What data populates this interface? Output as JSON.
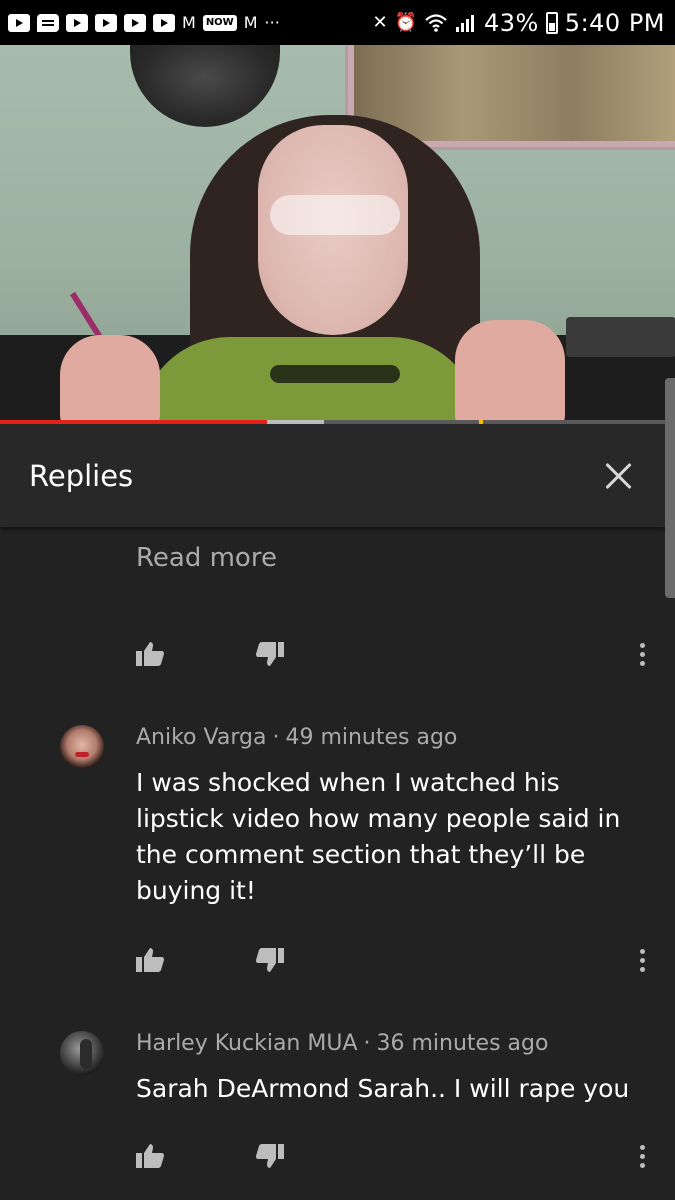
{
  "status_bar": {
    "notif_letter_1": "M",
    "notif_badge": "NOW",
    "notif_letter_2": "M",
    "overflow": "···",
    "battery_pct": "43%",
    "time": "5:40 PM"
  },
  "video": {
    "progress_fraction": 0.395,
    "buffer_fraction": 0.48,
    "marker_fraction": 0.71
  },
  "panel": {
    "title": "Replies"
  },
  "truncated_comment": {
    "read_more_label": "Read more"
  },
  "comments": [
    {
      "author": "Aniko Varga",
      "separator": "·",
      "time": "49 minutes ago",
      "text": "I was shocked when I watched his lipstick video how many people said in the comment section that they’ll be buying it!"
    },
    {
      "author": "Harley Kuckian MUA",
      "separator": "·",
      "time": "36 minutes ago",
      "text": "Sarah DeArmond Sarah.. I will rape you"
    }
  ],
  "colors": {
    "panel_bg": "#222222",
    "header_bg": "#282828",
    "progress_red": "#e62117",
    "muted_text": "#aaaaaa"
  },
  "icons": [
    "like-icon",
    "dislike-icon",
    "more-vert-icon",
    "close-icon",
    "wifi-icon",
    "signal-icon",
    "alarm-icon",
    "mute-icon",
    "battery-icon"
  ]
}
